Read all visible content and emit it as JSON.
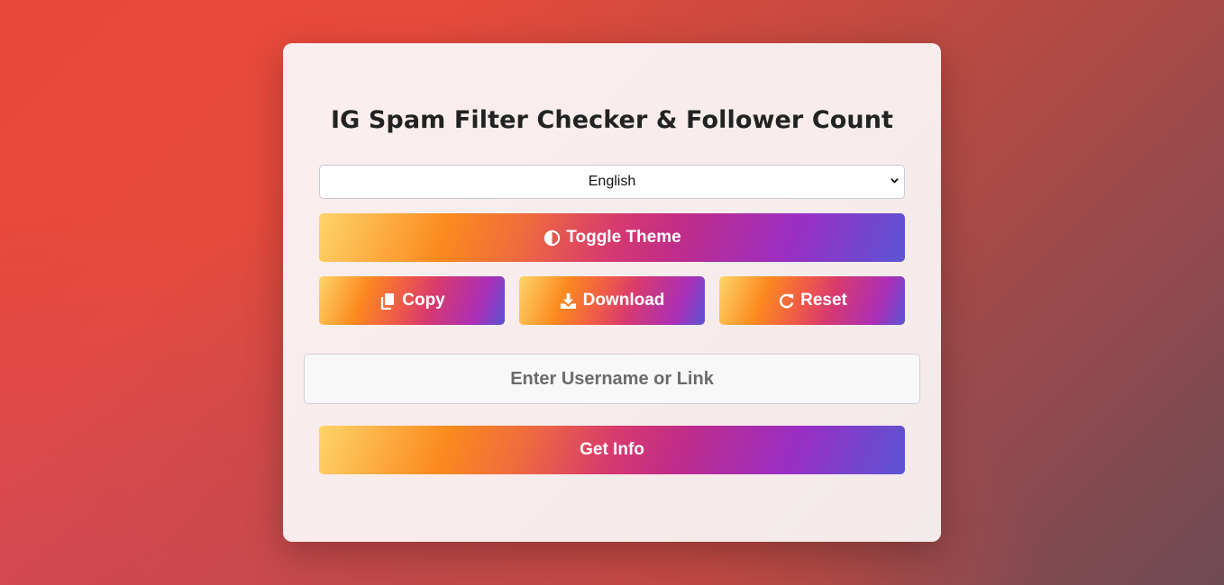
{
  "title": "IG Spam Filter Checker & Follower Count",
  "language_select": {
    "selected": "English"
  },
  "buttons": {
    "toggle_theme": "Toggle Theme",
    "copy": "Copy",
    "download": "Download",
    "reset": "Reset",
    "get_info": "Get Info"
  },
  "username_input": {
    "placeholder": "Enter Username or Link",
    "value": ""
  },
  "icons": {
    "toggle_theme": "half-circle-icon",
    "copy": "copy-icon",
    "download": "download-icon",
    "reset": "redo-icon"
  },
  "colors": {
    "gradient_start": "#fdd46a",
    "gradient_mid_orange": "#fb8a1e",
    "gradient_mid_pink": "#d73a6e",
    "gradient_mid_purple": "#9a2ec4",
    "gradient_end": "#5b55d4",
    "card_bg": "#f8ecec"
  }
}
